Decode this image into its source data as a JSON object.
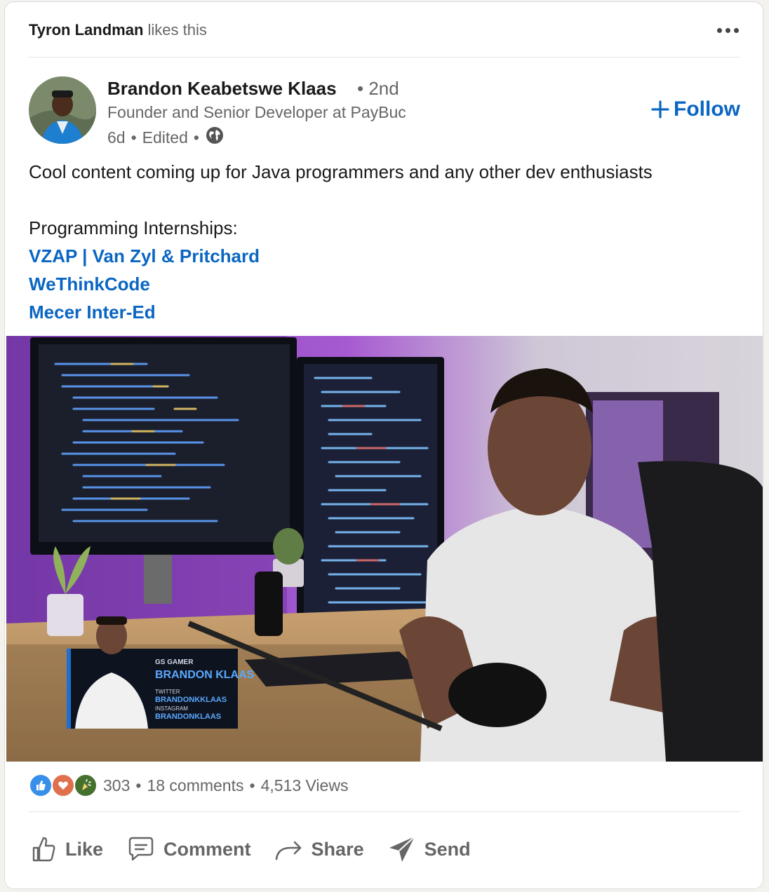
{
  "context": {
    "actor": "Tyron Landman",
    "action": "likes this"
  },
  "author": {
    "name": "Brandon Keabetswe Klaas",
    "degree": "2nd",
    "headline": "Founder and Senior Developer at PayBuc",
    "time": "6d",
    "edited": "Edited",
    "visibility_icon": "globe-icon"
  },
  "follow_label": "Follow",
  "post": {
    "text": "Cool content coming up for Java programmers and any other dev enthusiasts",
    "internships_heading": "Programming Internships:",
    "links": [
      "VZAP | Van Zyl & Pritchard",
      "WeThinkCode",
      "Mecer Inter-Ed"
    ]
  },
  "video_overlay": {
    "tag": "GS GAMER",
    "name": "BRANDON KLAAS",
    "twitter_label": "TWITTER",
    "twitter": "BRANDONKKLAAS",
    "instagram_label": "INSTAGRAM",
    "instagram": "BRANDONKLAAS"
  },
  "social": {
    "reaction_icons": [
      "like-icon",
      "love-icon",
      "celebrate-icon"
    ],
    "reactions_count": "303",
    "comments": "18 comments",
    "views": "4,513 Views"
  },
  "actions": [
    "Like",
    "Comment",
    "Share",
    "Send"
  ],
  "colors": {
    "brand": "#0a66c2",
    "muted": "#666666"
  }
}
